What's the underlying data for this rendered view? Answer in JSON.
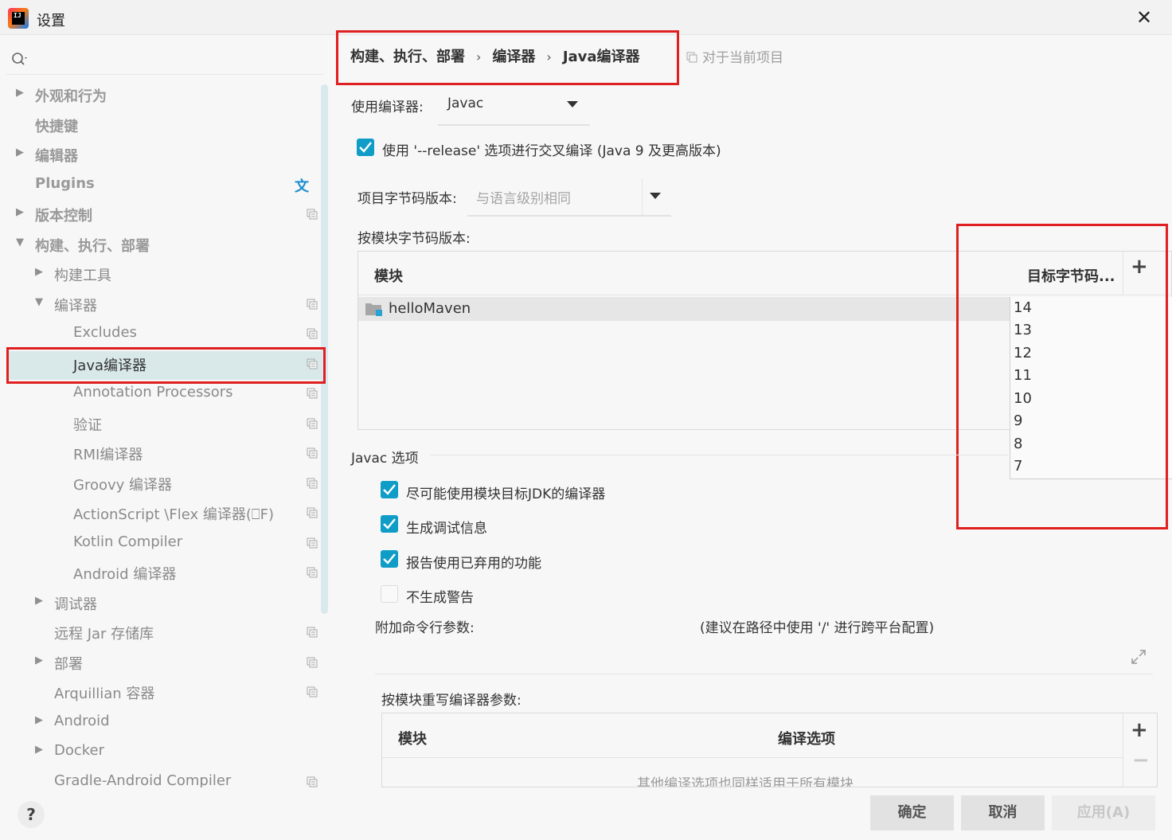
{
  "window": {
    "title": "设置",
    "close_glyph": "✕"
  },
  "sidebar": {
    "items": [
      {
        "label": "外观和行为",
        "arrow": "▶",
        "bold": true
      },
      {
        "label": "快捷键",
        "arrow": "",
        "bold": true
      },
      {
        "label": "编辑器",
        "arrow": "▶",
        "bold": true
      },
      {
        "label": "Plugins",
        "arrow": "",
        "bold": true
      },
      {
        "label": "版本控制",
        "arrow": "▶",
        "bold": true
      },
      {
        "label": "构建、执行、部署",
        "arrow": "▼",
        "bold": true
      },
      {
        "label": "构建工具",
        "arrow": "▶"
      },
      {
        "label": "编译器",
        "arrow": "▼"
      },
      {
        "label": "Excludes",
        "arrow": ""
      },
      {
        "label": "Java编译器",
        "arrow": "",
        "selected": true
      },
      {
        "label": "Annotation Processors",
        "arrow": ""
      },
      {
        "label": "验证",
        "arrow": ""
      },
      {
        "label": "RMI编译器",
        "arrow": ""
      },
      {
        "label": "Groovy 编译器",
        "arrow": ""
      },
      {
        "label": "ActionScript \\Flex 编译器(⎕F)",
        "arrow": ""
      },
      {
        "label": "Kotlin Compiler",
        "arrow": ""
      },
      {
        "label": "Android 编译器",
        "arrow": ""
      },
      {
        "label": "调试器",
        "arrow": "▶"
      },
      {
        "label": "远程 Jar 存储库",
        "arrow": ""
      },
      {
        "label": "部署",
        "arrow": "▶"
      },
      {
        "label": "Arquillian 容器",
        "arrow": ""
      },
      {
        "label": "Android",
        "arrow": "▶"
      },
      {
        "label": "Docker",
        "arrow": "▶"
      },
      {
        "label": "Gradle-Android Compiler",
        "arrow": ""
      }
    ]
  },
  "breadcrumb": {
    "items": [
      "构建、执行、部署",
      "编译器",
      "Java编译器"
    ],
    "separator": "›",
    "project_note": "对于当前项目"
  },
  "compiler": {
    "label": "使用编译器:",
    "value": "Javac",
    "release_option": "使用 '--release' 选项进行交叉编译 (Java 9 及更高版本)",
    "bytecode_label": "项目字节码版本:",
    "bytecode_placeholder": "与语言级别相同",
    "per_module_label": "按模块字节码版本:"
  },
  "module_table": {
    "col_module": "模块",
    "col_target": "目标字节码...",
    "rows": [
      {
        "module": "helloMaven",
        "target": "14"
      }
    ],
    "add_glyph": "+"
  },
  "version_options": [
    "14",
    "13",
    "12",
    "11",
    "10",
    "9",
    "8",
    "7"
  ],
  "javac": {
    "section_title": "Javac 选项",
    "options": [
      {
        "label": "尽可能使用模块目标JDK的编译器",
        "checked": true
      },
      {
        "label": "生成调试信息",
        "checked": true
      },
      {
        "label": "报告使用已弃用的功能",
        "checked": true
      },
      {
        "label": "不生成警告",
        "checked": false
      }
    ],
    "extra_args_label": "附加命令行参数:",
    "extra_args_hint": "(建议在路径中使用 '/' 进行跨平台配置)",
    "override_label": "按模块重写编译器参数:"
  },
  "override_table": {
    "col_module": "模块",
    "col_options": "编译选项",
    "empty_text": "其他编译选项也同样适用于所有模块",
    "add_glyph": "+",
    "remove_glyph": "−"
  },
  "footer": {
    "help": "?",
    "ok": "确定",
    "cancel": "取消",
    "apply": "应用(A)"
  },
  "colors": {
    "accent": "#0f9dc8",
    "highlight_box": "#e02020",
    "selected_row": "#d9e9ea"
  }
}
